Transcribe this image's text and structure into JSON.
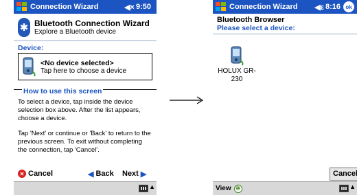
{
  "left": {
    "titlebar": {
      "title": "Connection Wizard",
      "speaker": "◀×",
      "time": "9:50"
    },
    "header": {
      "title": "Bluetooth Connection Wizard",
      "subtitle": "Explore a Bluetooth device"
    },
    "device_section": {
      "label": "Device:",
      "selection": "<No device selected>",
      "hint": "Tap here to choose a device"
    },
    "howto": {
      "label": "How to use this screen",
      "para1": "To select a device, tap inside the device selection box above. After the list appears, choose a device.",
      "para2": "Tap 'Next' or continue or 'Back' to return to the previous screen. To exit without completing the connection, tap 'Cancel'."
    },
    "actions": {
      "cancel": "Cancel",
      "back": "Back",
      "next": "Next"
    }
  },
  "right": {
    "titlebar": {
      "title": "Connection Wizard",
      "speaker": "◀ε",
      "time": "8:16",
      "ok": "ok"
    },
    "browser": {
      "title": "Bluetooth Browser",
      "subtitle": "Please select a device:"
    },
    "devices": [
      {
        "label": "HOLUX GR-230"
      }
    ],
    "cancel_button": "Cancel",
    "menu": {
      "view": "View"
    }
  },
  "colors": {
    "titlebar": "#1c54c2",
    "accent_text": "#1c54c2",
    "menubar": "#d8d8d8"
  }
}
